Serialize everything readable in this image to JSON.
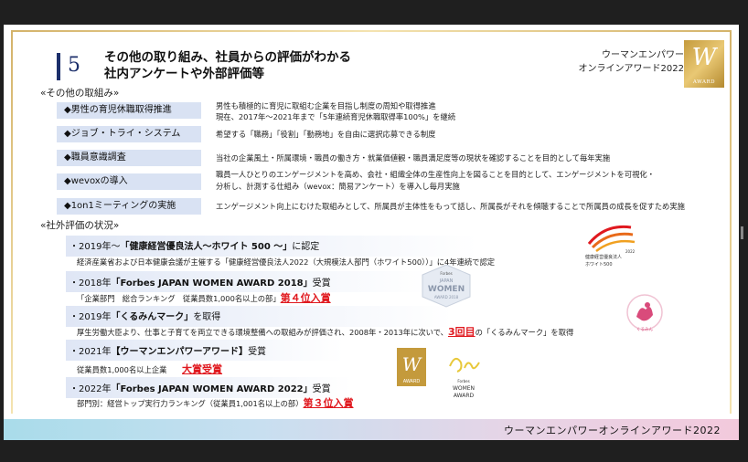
{
  "slide": {
    "section_number": "5",
    "title_line1": "その他の取り組み、社員からの評価がわかる",
    "title_line2": "社内アンケートや外部評価等",
    "brand_line1": "ウーマンエンパワー",
    "brand_line2": "オンラインアワード2022",
    "award_logo_text": "AWARD",
    "other_heading": "«その他の取組み»",
    "other_items": [
      {
        "label": "◆男性の育児休職取得推進",
        "desc1": "男性も積極的に育児に取組む企業を目指し制度の周知や取得推進",
        "desc2": "現在、2017年～2021年まで「5年連続育児休職取得率100%」を継続"
      },
      {
        "label": "◆ジョブ・トライ・システム",
        "desc1": "希望する「職務」「役割」「勤務地」を自由に選択応募できる制度",
        "desc2": ""
      },
      {
        "label": "◆職員意識調査",
        "desc1": "当社の企業風土・所属環境・職員の働き方・就業価値観・職員満足度等の現状を確認することを目的として毎年実施",
        "desc2": ""
      },
      {
        "label": "◆wevoxの導入",
        "desc1": "職員一人ひとりのエンゲージメントを高め、会社・組織全体の生産性向上を図ることを目的として、エンゲージメントを可視化・",
        "desc2": "分析し、計測する仕組み（wevox：簡易アンケート）を導入し毎月実施"
      },
      {
        "label": "◆1on1ミーティングの実施",
        "desc1": "エンゲージメント向上にむけた取組みとして、所属員が主体性をもって話し、所属長がそれを傾聴することで所属員の成長を促すため実施",
        "desc2": ""
      }
    ],
    "eval_heading": "«社外評価の状況»",
    "evals": [
      {
        "head_pre": "・2019年～",
        "head_bold": "「健康経営優良法人～ホワイト 500 ～」",
        "head_post": "に認定",
        "sub_pre": "経済産業省および日本健康会議が主催する「健康経営優良法人2022（大規模法人部門（ホワイト500））」に4年連続で認定",
        "sub_red": "",
        "sub_post": ""
      },
      {
        "head_pre": "・2018年",
        "head_bold": "「Forbes JAPAN WOMEN AWARD 2018」",
        "head_post": "受賞",
        "sub_pre": "「企業部門　総合ランキング　従業員数1,000名以上の部」",
        "sub_red": "第４位入賞",
        "sub_post": ""
      },
      {
        "head_pre": "・2019年",
        "head_bold": "「くるみんマーク」",
        "head_post": "を取得",
        "sub_pre": "厚生労働大臣より、仕事と子育てを両立できる環境整備への取組みが評価され、2008年・2013年に次いで、",
        "sub_red": "3回目",
        "sub_post": "の「くるみんマーク」を取得"
      },
      {
        "head_pre": "・2021年",
        "head_bold": "【ウーマンエンパワーアワード】",
        "head_post": "受賞",
        "sub_pre": "従業員数1,000名以上企業",
        "sub_red": "大賞受賞",
        "sub_post": ""
      },
      {
        "head_pre": "・2022年",
        "head_bold": "「Forbes JAPAN WOMEN AWARD 2022」",
        "head_post": "受賞",
        "sub_pre": "部門別：経営トップ実行力ランキング（従業員1,001名以上の部）",
        "sub_red": "第３位入賞",
        "sub_post": ""
      }
    ],
    "marks": {
      "health_caption1": "健康経営優良法人",
      "health_caption2": "ホワイト500",
      "health_year": "2022",
      "forbes_2018_line1": "Forbes",
      "forbes_2018_line2": "JAPAN",
      "forbes_2018_line3": "WOMEN",
      "forbes_2018_line4": "AWARD 2018",
      "kurumin_text": "くるみん",
      "forbes_2022_line1": "Forbes",
      "forbes_2022_line2": "WOMEN",
      "forbes_2022_line3": "AWARD",
      "award2021_text": "AWARD"
    },
    "footer": "ウーマンエンパワーオンラインアワード2022"
  },
  "colors": {
    "navy": "#1c2f6b",
    "gold": "#c49a3c",
    "red_highlight": "#e0191f",
    "label_bg": "#d9e2f3"
  }
}
